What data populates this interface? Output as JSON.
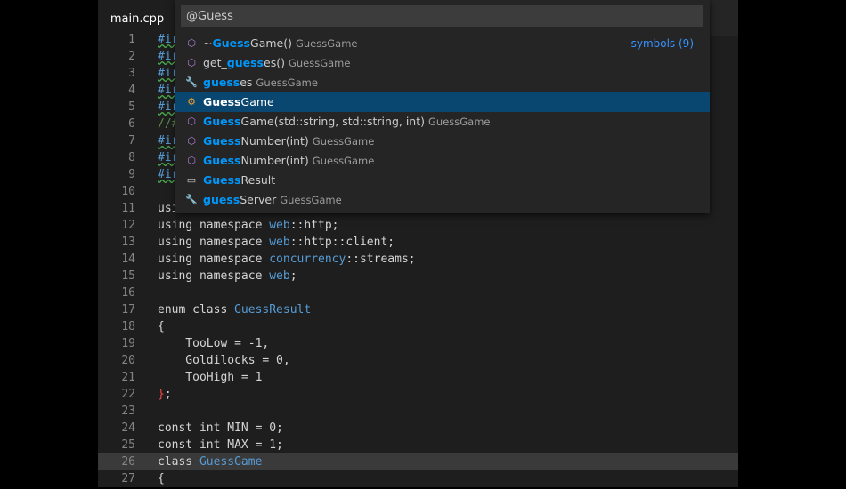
{
  "editor": {
    "tab_label": "main.cpp",
    "lines": [
      {
        "n": "1",
        "segs": [
          [
            "#ir",
            "ns squiggle"
          ]
        ]
      },
      {
        "n": "2",
        "segs": [
          [
            "#ir",
            "ns squiggle"
          ]
        ]
      },
      {
        "n": "3",
        "segs": [
          [
            "#ir",
            "ns squiggle"
          ]
        ]
      },
      {
        "n": "4",
        "segs": [
          [
            "#ir",
            "ns squiggle"
          ]
        ]
      },
      {
        "n": "5",
        "segs": [
          [
            "#ir",
            "ns squiggle"
          ]
        ]
      },
      {
        "n": "6",
        "segs": [
          [
            "//#",
            "comment"
          ]
        ]
      },
      {
        "n": "7",
        "segs": [
          [
            "#ir",
            "ns squiggle"
          ]
        ]
      },
      {
        "n": "8",
        "segs": [
          [
            "#ir",
            "ns squiggle"
          ]
        ]
      },
      {
        "n": "9",
        "segs": [
          [
            "#ir",
            "ns squiggle"
          ]
        ]
      },
      {
        "n": "10",
        "segs": []
      },
      {
        "n": "11",
        "segs": [
          [
            "usi",
            "kw"
          ]
        ]
      },
      {
        "n": "12",
        "segs": [
          [
            "using namespace ",
            "kw"
          ],
          [
            "web",
            "ns"
          ],
          [
            "::http;",
            "kw"
          ]
        ]
      },
      {
        "n": "13",
        "segs": [
          [
            "using namespace ",
            "kw"
          ],
          [
            "web",
            "ns"
          ],
          [
            "::http::client;",
            "kw"
          ]
        ]
      },
      {
        "n": "14",
        "segs": [
          [
            "using namespace ",
            "kw"
          ],
          [
            "concurrency",
            "ns"
          ],
          [
            "::streams;",
            "kw"
          ]
        ]
      },
      {
        "n": "15",
        "segs": [
          [
            "using namespace ",
            "kw"
          ],
          [
            "web",
            "ns"
          ],
          [
            ";",
            "kw"
          ]
        ]
      },
      {
        "n": "16",
        "segs": []
      },
      {
        "n": "17",
        "segs": [
          [
            "enum class ",
            "kw"
          ],
          [
            "GuessResult",
            "ns"
          ]
        ]
      },
      {
        "n": "18",
        "segs": [
          [
            "{",
            "kw"
          ]
        ]
      },
      {
        "n": "19",
        "segs": [
          [
            "    TooLow = -1,",
            "kw"
          ]
        ]
      },
      {
        "n": "20",
        "segs": [
          [
            "    Goldilocks = 0,",
            "kw"
          ]
        ]
      },
      {
        "n": "21",
        "segs": [
          [
            "    TooHigh = 1",
            "kw"
          ]
        ]
      },
      {
        "n": "22",
        "segs": [
          [
            "}",
            "red"
          ],
          [
            ";",
            "kw"
          ]
        ]
      },
      {
        "n": "23",
        "segs": []
      },
      {
        "n": "24",
        "segs": [
          [
            "const int MIN = 0;",
            "kw"
          ]
        ]
      },
      {
        "n": "25",
        "segs": [
          [
            "const int MAX = 1;",
            "kw"
          ]
        ]
      },
      {
        "n": "26",
        "segs": [
          [
            "class ",
            "kw"
          ],
          [
            "GuessGame",
            "ns"
          ]
        ],
        "current": true
      },
      {
        "n": "27",
        "segs": [
          [
            "{",
            "kw"
          ]
        ]
      }
    ]
  },
  "quick_open": {
    "query": "@Guess",
    "badge": "symbols (9)",
    "items": [
      {
        "icon": "method-icon",
        "glyph": "⬡",
        "iconClass": "i-method",
        "parts": [
          [
            "~",
            ""
          ],
          [
            "Guess",
            "hl"
          ],
          [
            "Game()",
            ""
          ]
        ],
        "desc": "GuessGame"
      },
      {
        "icon": "method-icon",
        "glyph": "⬡",
        "iconClass": "i-method",
        "parts": [
          [
            "get_",
            ""
          ],
          [
            "guess",
            "hl"
          ],
          [
            "es()",
            ""
          ]
        ],
        "desc": "GuessGame"
      },
      {
        "icon": "wrench-icon",
        "glyph": "🔧",
        "iconClass": "i-prop",
        "parts": [
          [
            "guess",
            "hl"
          ],
          [
            "es",
            ""
          ]
        ],
        "desc": "GuessGame"
      },
      {
        "icon": "class-icon",
        "glyph": "⚙",
        "iconClass": "i-class",
        "parts": [
          [
            "Guess",
            "hl"
          ],
          [
            "Game",
            ""
          ]
        ],
        "desc": "",
        "selected": true
      },
      {
        "icon": "method-icon",
        "glyph": "⬡",
        "iconClass": "i-method",
        "parts": [
          [
            "Guess",
            "hl"
          ],
          [
            "Game(std::string, std::string, int)",
            ""
          ]
        ],
        "desc": "GuessGame"
      },
      {
        "icon": "method-icon",
        "glyph": "⬡",
        "iconClass": "i-method",
        "parts": [
          [
            "Guess",
            "hl"
          ],
          [
            "Number(int)",
            ""
          ]
        ],
        "desc": "GuessGame"
      },
      {
        "icon": "method-icon",
        "glyph": "⬡",
        "iconClass": "i-method",
        "parts": [
          [
            "Guess",
            "hl"
          ],
          [
            "Number(int)",
            ""
          ]
        ],
        "desc": "GuessGame"
      },
      {
        "icon": "enum-icon",
        "glyph": "▭",
        "iconClass": "i-enum",
        "parts": [
          [
            "Guess",
            "hl"
          ],
          [
            "Result",
            ""
          ]
        ],
        "desc": ""
      },
      {
        "icon": "wrench-icon",
        "glyph": "🔧",
        "iconClass": "i-prop",
        "parts": [
          [
            "guess",
            "hl"
          ],
          [
            "Server",
            ""
          ]
        ],
        "desc": "GuessGame"
      }
    ]
  }
}
